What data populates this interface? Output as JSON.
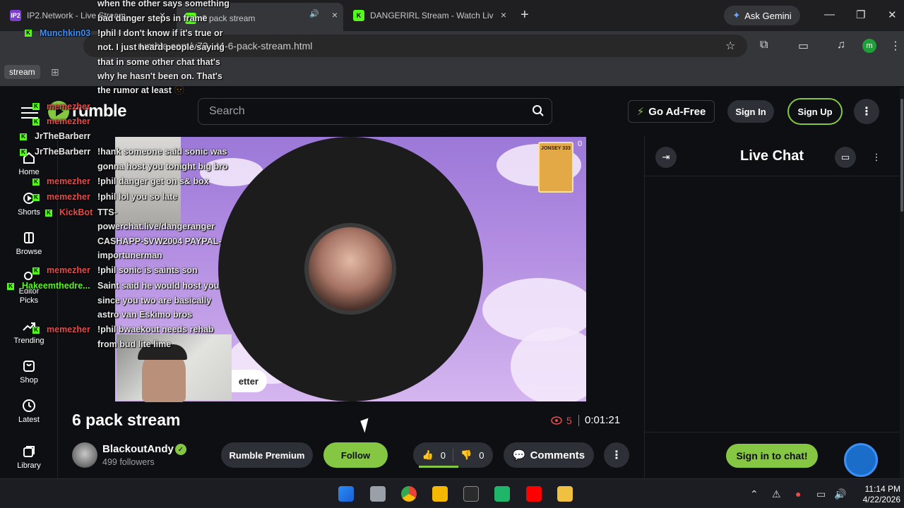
{
  "browser": {
    "tabs": [
      {
        "favicon": "IP2",
        "title": "IP2.Network - Live Stream",
        "close": "×"
      },
      {
        "favicon": "K",
        "title": "6 pack stream",
        "audio": "🔊",
        "close": "×"
      },
      {
        "favicon": "K",
        "title": "DANGERIRL Stream - Watch Liv",
        "close": "×"
      }
    ],
    "new_tab": "+",
    "gemini_label": "Ask Gemini",
    "url": "rumble.com/v73...t4-6-pack-stream.html",
    "profile_initial": "m",
    "bookmark_chip": "stream"
  },
  "header": {
    "logo_text": "rumble",
    "search_placeholder": "Search",
    "ad_free_label": "Go Ad-Free",
    "sign_in_label": "Sign In",
    "sign_up_label": "Sign Up"
  },
  "leftnav": [
    {
      "label": "Home"
    },
    {
      "label": "Shorts"
    },
    {
      "label": "Browse"
    },
    {
      "label": "Editor Picks"
    },
    {
      "label": "Trending"
    },
    {
      "label": "Shop"
    },
    {
      "label": "Latest"
    },
    {
      "label": "Library"
    }
  ],
  "overlay_chat": {
    "top_lines": [
      "when the other says something",
      "bad danger steps in frame",
      "!phil I don't know if it's true or",
      "not. I just heard people saying",
      "that in some other chat that's",
      "why he hasn't been on. That's",
      "the rumor at least 🫥"
    ],
    "top_user": "Munchkin03",
    "users": [
      "memezher",
      "memezher",
      "JrTheBarberr",
      "JrTheBarberr",
      "memezher",
      "memezher",
      "KickBot",
      "memezher",
      "Hakeemthedre...",
      "memezher"
    ],
    "messages": [
      "!hank someone said sonic was",
      "gonna host you tonight big bro",
      "!phil danger get on s& box",
      "!phil lol you so late",
      "TTS-",
      "powerchat.live/dangeranger",
      "CASHAPP-$VW2004 PAYPAL-",
      "importunerman",
      "!phil sonic is saints son",
      "Saint said he would host you",
      "since you two are basically",
      "astro van Eskimo bros",
      "!phil bwaekout needs rehab",
      "from bud lite lime"
    ],
    "sticker_text": "JONSEY 333",
    "sticker_count": "0",
    "better_label": "etter"
  },
  "video": {
    "title": "6 pack stream",
    "viewers": "5",
    "duration": "0:01:21"
  },
  "channel": {
    "name": "BlackoutAndy",
    "followers": "499 followers"
  },
  "actions": {
    "premium_label": "Rumble Premium",
    "follow_label": "Follow",
    "likes": "0",
    "dislikes": "0",
    "comments_label": "Comments"
  },
  "chat": {
    "title": "Live Chat",
    "sign_in_label": "Sign in to chat!"
  },
  "taskbar": {
    "time": "11:14 PM",
    "date": "4/22/2026"
  },
  "colors": {
    "brand_green": "#85c742",
    "live_red": "#e64b4b",
    "kick_green": "#53fc18"
  }
}
